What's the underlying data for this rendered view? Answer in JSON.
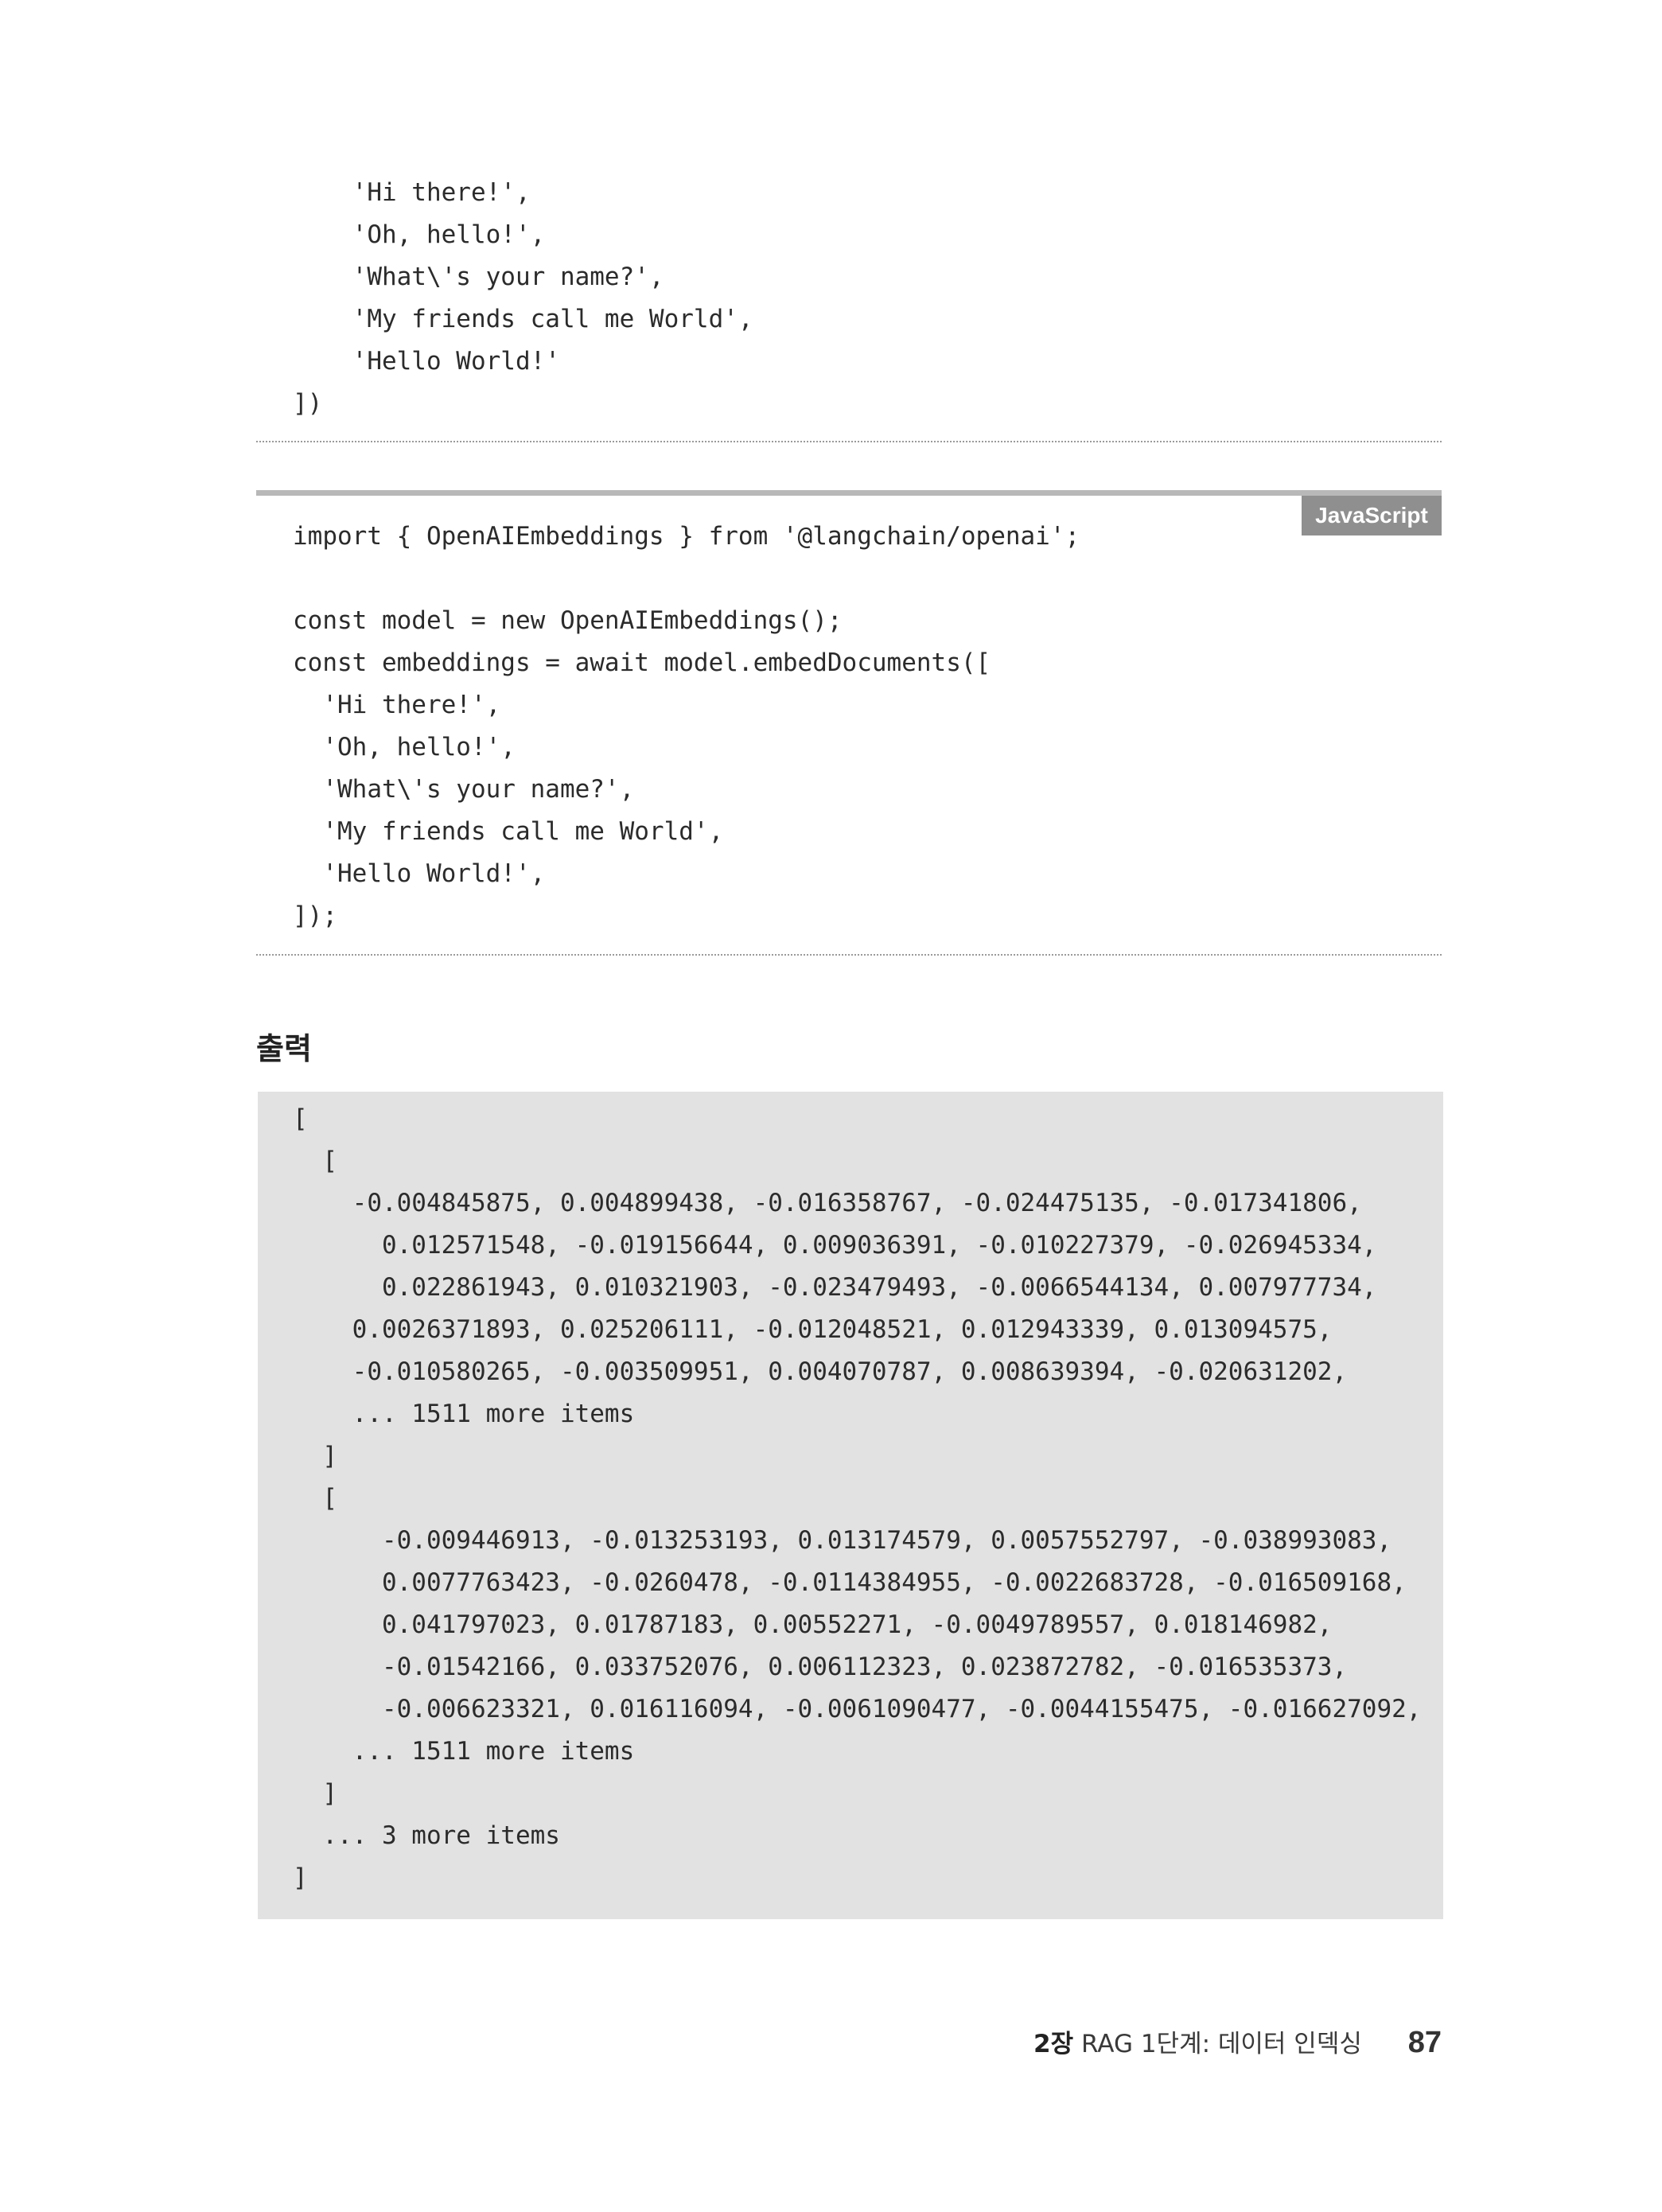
{
  "code_block_1": {
    "lines": [
      "    'Hi there!',",
      "    'Oh, hello!',",
      "    'What\\'s your name?',",
      "    'My friends call me World',",
      "    'Hello World!'",
      "])"
    ]
  },
  "code_block_2": {
    "language_label": "JavaScript",
    "lines": [
      "import { OpenAIEmbeddings } from '@langchain/openai';",
      "",
      "const model = new OpenAIEmbeddings();",
      "const embeddings = await model.embedDocuments([",
      "  'Hi there!',",
      "  'Oh, hello!',",
      "  'What\\'s your name?',",
      "  'My friends call me World',",
      "  'Hello World!',",
      "]);"
    ]
  },
  "output_section": {
    "heading": "출력",
    "lines": [
      "[",
      "  [",
      "    -0.004845875, 0.004899438, -0.016358767, -0.024475135, -0.017341806,",
      "      0.012571548, -0.019156644, 0.009036391, -0.010227379, -0.026945334,",
      "      0.022861943, 0.010321903, -0.023479493, -0.0066544134, 0.007977734,",
      "    0.0026371893, 0.025206111, -0.012048521, 0.012943339, 0.013094575,",
      "    -0.010580265, -0.003509951, 0.004070787, 0.008639394, -0.020631202,",
      "    ... 1511 more items",
      "  ]",
      "  [",
      "      -0.009446913, -0.013253193, 0.013174579, 0.0057552797, -0.038993083,",
      "      0.0077763423, -0.0260478, -0.0114384955, -0.0022683728, -0.016509168,",
      "      0.041797023, 0.01787183, 0.00552271, -0.0049789557, 0.018146982,",
      "      -0.01542166, 0.033752076, 0.006112323, 0.023872782, -0.016535373,",
      "      -0.006623321, 0.016116094, -0.0061090477, -0.0044155475, -0.016627092,",
      "    ... 1511 more items",
      "  ]",
      "  ... 3 more items",
      "]"
    ]
  },
  "footer": {
    "chapter": "2장",
    "section_title": "RAG 1단계: 데이터 인덱싱",
    "page_number": "87"
  }
}
